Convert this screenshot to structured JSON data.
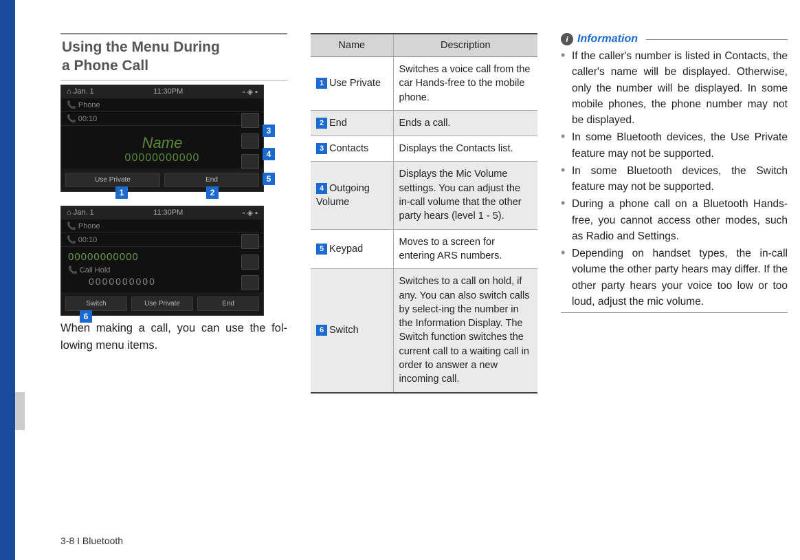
{
  "section_title_line1": "Using the Menu During",
  "section_title_line2": "a Phone Call",
  "screenshot1": {
    "status_left": "Jan. 1",
    "status_time": "11:30PM",
    "phone_label": "Phone",
    "timer": "00:10",
    "caller_name": "Name",
    "caller_number": "00000000000",
    "btn_use_private": "Use Private",
    "btn_end": "End"
  },
  "screenshot2": {
    "status_left": "Jan. 1",
    "status_time": "11:30PM",
    "phone_label": "Phone",
    "timer": "00:10",
    "active_number": "00000000000",
    "hold_label": "Call Hold",
    "hold_number": "0000000000",
    "btn_switch": "Switch",
    "btn_use_private": "Use Private",
    "btn_end": "End"
  },
  "callouts": {
    "c1": "1",
    "c2": "2",
    "c3": "3",
    "c4": "4",
    "c5": "5",
    "c6": "6"
  },
  "paragraph1": "When making a call, you can use the fol-lowing menu items.",
  "table": {
    "header_name": "Name",
    "header_desc": "Description",
    "rows": [
      {
        "num": "1",
        "name": "Use Private",
        "desc": "Switches a voice call from the car Hands-free to the mobile phone."
      },
      {
        "num": "2",
        "name": "End",
        "desc": "Ends a call."
      },
      {
        "num": "3",
        "name": "Contacts",
        "desc": "Displays the Contacts list."
      },
      {
        "num": "4",
        "name": "Outgoing Volume",
        "desc": "Displays the Mic Volume settings. You can adjust the in-call volume that the other party hears (level 1 - 5)."
      },
      {
        "num": "5",
        "name": "Keypad",
        "desc": "Moves to a screen for entering ARS numbers."
      },
      {
        "num": "6",
        "name": "Switch",
        "desc": "Switches to a call on hold, if any. You can also switch calls by select-ing the number in the Information Display. The Switch function switches the current call to a waiting call in order to answer a new incoming call."
      }
    ]
  },
  "info_title": "Information",
  "info_items": [
    "If the caller's number is listed in Contacts, the caller's name will be displayed. Otherwise, only the number will be displayed. In some mobile phones, the phone number may not be displayed.",
    "In some Bluetooth devices, the Use Private feature may not be supported.",
    "In some Bluetooth devices, the Switch feature may not be supported.",
    "During a phone call on a Bluetooth Hands-free, you cannot access other modes, such as Radio and Settings.",
    "Depending on handset types, the in-call volume the other party hears may differ. If the other party hears your voice too low or too loud, adjust the mic volume."
  ],
  "footer": "3-8 I Bluetooth"
}
